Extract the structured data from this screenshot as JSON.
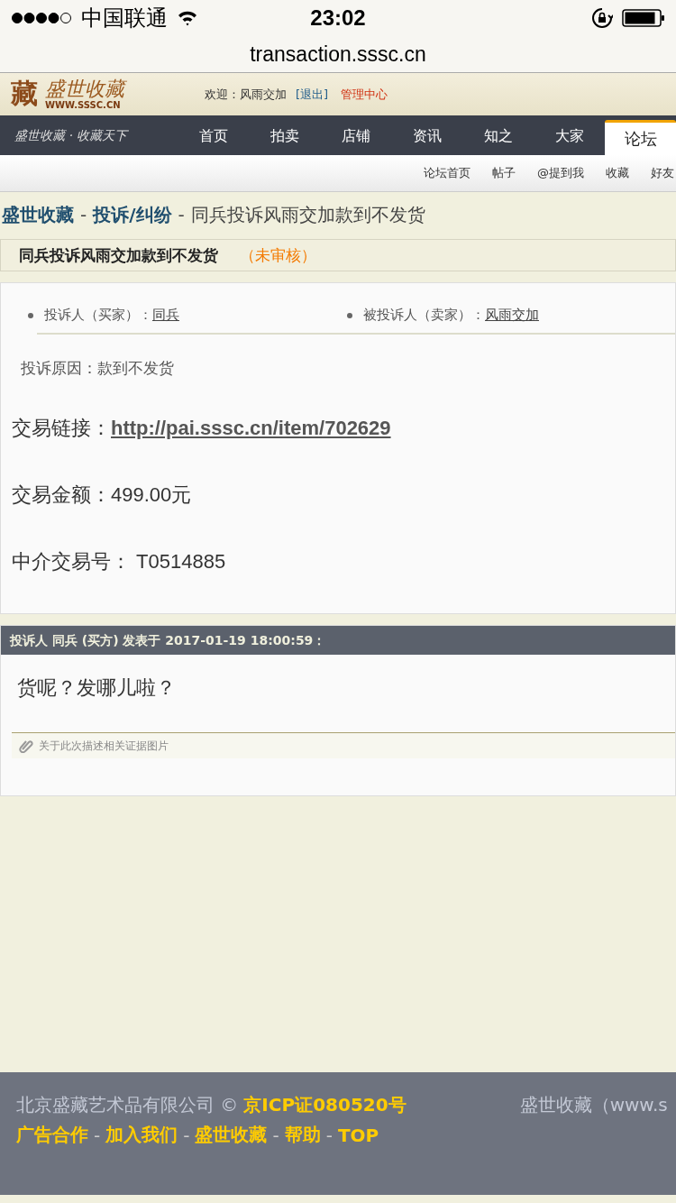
{
  "status_bar": {
    "carrier": "中国联通",
    "time": "23:02"
  },
  "address_bar": {
    "url": "transaction.sssc.cn"
  },
  "header": {
    "logo_seal": "藏",
    "logo_text": "盛世收藏",
    "logo_url": "WWW.SSSC.CN",
    "welcome": "欢迎：风雨交加",
    "logout": "[退出]",
    "admin": "管理中心"
  },
  "nav": {
    "slogan": "盛世收藏 · 收藏天下",
    "items": [
      {
        "label": "首页",
        "selected": false
      },
      {
        "label": "拍卖",
        "selected": false
      },
      {
        "label": "店铺",
        "selected": false
      },
      {
        "label": "资讯",
        "selected": false
      },
      {
        "label": "知之",
        "selected": false
      },
      {
        "label": "大家",
        "selected": false
      },
      {
        "label": "论坛",
        "selected": true
      }
    ]
  },
  "sub_nav": [
    "论坛首页",
    "帖子",
    "@提到我",
    "收藏",
    "好友"
  ],
  "breadcrumb": {
    "links": [
      "盛世收藏",
      "投诉/纠纷"
    ],
    "separator": "-",
    "current": "同兵投诉风雨交加款到不发货"
  },
  "title_bar": {
    "title": "同兵投诉风雨交加款到不发货",
    "status": "（未审核）"
  },
  "complaint": {
    "parties": [
      {
        "label": "投诉人（买家）：",
        "name": "同兵"
      },
      {
        "label": "被投诉人（卖家）：",
        "name": "风雨交加"
      }
    ],
    "reason": "投诉原因：款到不发货",
    "link_label": "交易链接：",
    "link": "http://pai.sssc.cn/item/702629",
    "amount": "交易金额：499.00元",
    "escrow_no": "中介交易号：  T0514885"
  },
  "post": {
    "header": "投诉人 同兵 (买方) 发表于 2017-01-19 18:00:59：",
    "body": "货呢？发哪儿啦？",
    "attachment": "关于此次描述相关证据图片"
  },
  "footer": {
    "company": "北京盛藏艺术品有限公司 ©",
    "icp": "京ICP证080520号",
    "site": "盛世收藏（www.s",
    "links": [
      "广告合作",
      "加入我们",
      "盛世收藏",
      "帮助",
      "TOP"
    ],
    "separator": "-"
  }
}
